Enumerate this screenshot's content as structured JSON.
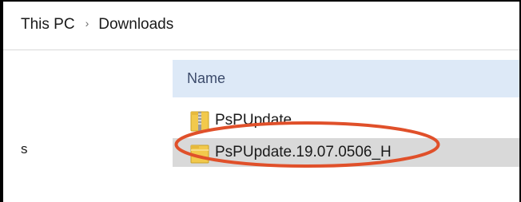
{
  "breadcrumb": {
    "items": [
      "This PC",
      "Downloads"
    ],
    "separator": "›"
  },
  "nav_pane": {
    "partial_item": "s"
  },
  "file_list": {
    "column_header": "Name",
    "files": [
      {
        "name": "PsPUpdate",
        "icon": "zip-folder-icon",
        "selected": false
      },
      {
        "name": "PsPUpdate.19.07.0506_H",
        "icon": "folder-icon",
        "selected": true
      }
    ]
  },
  "annotation": {
    "type": "oval-highlight",
    "color": "#e0502a"
  },
  "colors": {
    "header_bg": "#dde9f7",
    "selected_row_bg": "#d9d9d9",
    "folder_yellow": "#f2c94c"
  }
}
